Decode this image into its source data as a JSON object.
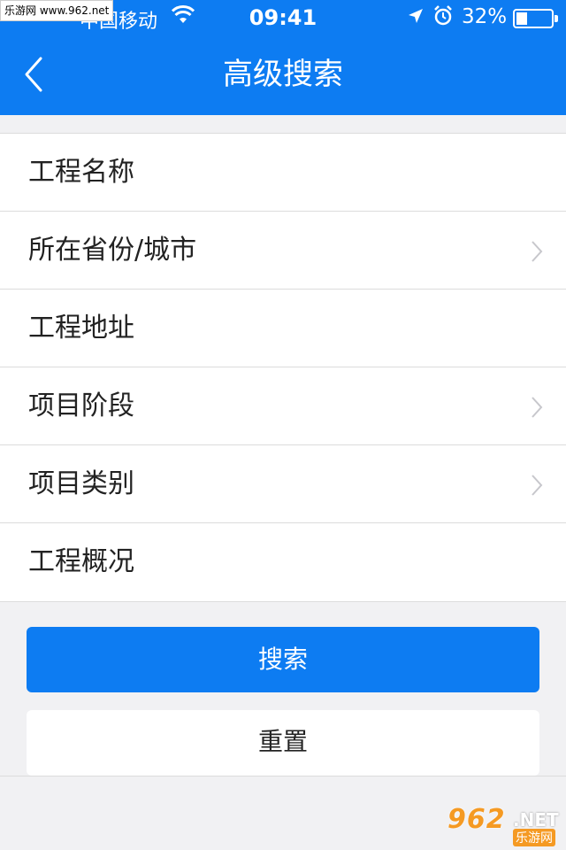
{
  "watermark_top": "乐游网 www.962.net",
  "status_bar": {
    "carrier": "中国移动",
    "time": "09:41",
    "battery_percent": "32%",
    "battery_level": 0.32
  },
  "nav": {
    "title": "高级搜索"
  },
  "form": {
    "rows": [
      {
        "label": "工程名称",
        "has_chevron": false
      },
      {
        "label": "所在省份/城市",
        "has_chevron": true
      },
      {
        "label": "工程地址",
        "has_chevron": false
      },
      {
        "label": "项目阶段",
        "has_chevron": true
      },
      {
        "label": "项目类别",
        "has_chevron": true
      },
      {
        "label": "工程概况",
        "has_chevron": false
      }
    ]
  },
  "actions": {
    "search_label": "搜索",
    "reset_label": "重置"
  },
  "logo_watermark": {
    "number": "962",
    "suffix": ".NET",
    "cn_text": "乐游网"
  },
  "colors": {
    "brand_blue": "#0d7cf2",
    "background": "#f1f1f3",
    "watermark_orange": "#f59a23"
  }
}
